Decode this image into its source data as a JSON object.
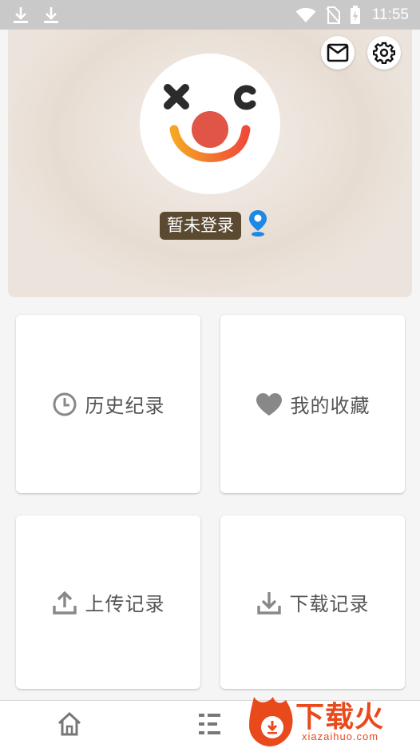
{
  "status_bar": {
    "time": "11:55",
    "icons": [
      "download-icon",
      "download-icon",
      "wifi-icon",
      "no-sim-icon",
      "battery-charging-icon"
    ]
  },
  "header": {
    "login_label": "暂未登录",
    "icons": [
      "mail-icon",
      "settings-icon",
      "location-icon"
    ]
  },
  "tiles": [
    {
      "label": "历史纪录",
      "icon": "clock-icon"
    },
    {
      "label": "我的收藏",
      "icon": "heart-icon"
    },
    {
      "label": "上传记录",
      "icon": "upload-icon"
    },
    {
      "label": "下载记录",
      "icon": "download-icon"
    }
  ],
  "bottom_nav": {
    "items": [
      "home-icon",
      "list-icon"
    ]
  },
  "watermark": {
    "title": "下载火",
    "url": "xiazaihuo.com"
  },
  "colors": {
    "status_bar": "#c9c9c9",
    "login_badge": "#5b4a32",
    "location": "#1e88e5",
    "clown_red": "#e05545",
    "watermark": "#e84a1c"
  }
}
